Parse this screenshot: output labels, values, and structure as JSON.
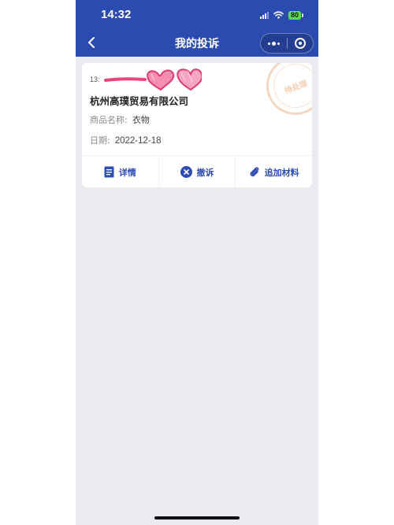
{
  "status_bar": {
    "time": "14:32",
    "battery": "80"
  },
  "nav": {
    "title": "我的投诉"
  },
  "complaint": {
    "phone_prefix": "13:",
    "phone_suffix": "7",
    "company": "杭州高璞贸易有限公司",
    "product_label": "商品名称:",
    "product_value": "衣物",
    "date_label": "日期:",
    "date_value": "2022-12-18",
    "stamp_text": "待处理"
  },
  "actions": [
    {
      "label": "详情",
      "icon": "document-icon"
    },
    {
      "label": "撤诉",
      "icon": "close-circle-icon"
    },
    {
      "label": "追加材料",
      "icon": "paperclip-icon"
    }
  ],
  "colors": {
    "nav_bg": "#2b4bb0",
    "page_bg": "#e9ebf1",
    "accent": "#2d4db5",
    "battery": "#5ddb5d",
    "stamp": "#f4d7c0",
    "scribble": "#e8457a"
  }
}
